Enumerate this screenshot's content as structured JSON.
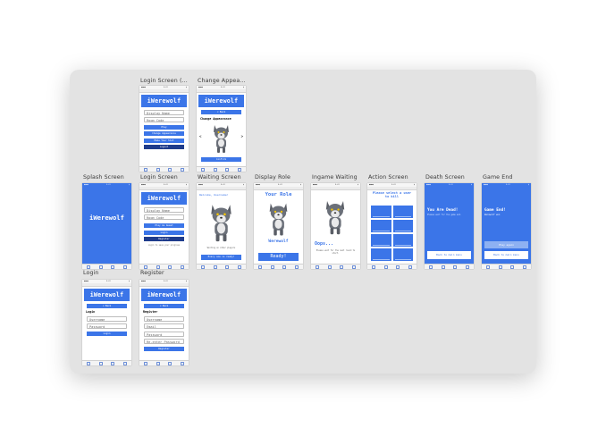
{
  "frames": {
    "login_screen_2": {
      "label": "Login Screen (...",
      "app_title": "iWerewolf",
      "fields": [
        "Display Name",
        "Room Code"
      ],
      "buttons": [
        "Play",
        "Change Appearance",
        "Make Your Slot"
      ],
      "dark_button": "Logout"
    },
    "change_appearance": {
      "label": "Change Appea...",
      "back": "< Back",
      "heading": "Change Appearance",
      "prev": "<",
      "next": ">",
      "confirm": "Confirm"
    },
    "splash": {
      "label": "Splash Screen",
      "app_title": "iWerewolf"
    },
    "login_screen": {
      "label": "Login Screen",
      "app_title": "iWerewolf",
      "fields": [
        "Display Name",
        "Room Code"
      ],
      "buttons": [
        "Play As Guest",
        "Login"
      ],
      "dark_button": "Register",
      "note": "Login to save your progress"
    },
    "waiting": {
      "label": "Waiting Screen",
      "heading": "Welcome, Username!",
      "caption": "Waiting on other players",
      "button": "Every one is ready!"
    },
    "display_role": {
      "label": "Display Role",
      "heading": "Your Role",
      "role": "Werewolf",
      "button": "Ready!"
    },
    "ingame_waiting": {
      "label": "Ingame Waiting",
      "heading": "Oops...",
      "caption": "Please wait for the next round to start."
    },
    "action": {
      "label": "Action Screen",
      "heading": "Please select a user to kill"
    },
    "death": {
      "label": "Death Screen",
      "heading": "You Are Dead!",
      "subtext": "Please wait for the game end.",
      "button": "Back to main menu"
    },
    "game_end": {
      "label": "Game End",
      "heading": "Game End!",
      "subtext": "Werewolf won",
      "button1": "Play again",
      "button2": "Back to main menu"
    },
    "login": {
      "label": "Login",
      "app_title": "iWerewolf",
      "back": "< Back",
      "heading": "Login",
      "fields": [
        "Username",
        "Password"
      ],
      "button": "Login"
    },
    "register": {
      "label": "Register",
      "app_title": "iWerewolf",
      "back": "< Back",
      "heading": "Register",
      "fields": [
        "Username",
        "Email",
        "Password",
        "Re-enter Password"
      ],
      "button": "Register"
    }
  },
  "colors": {
    "accent": "#3b75e8",
    "dark": "#1f3c8c",
    "canvas": "#e3e3e3"
  }
}
